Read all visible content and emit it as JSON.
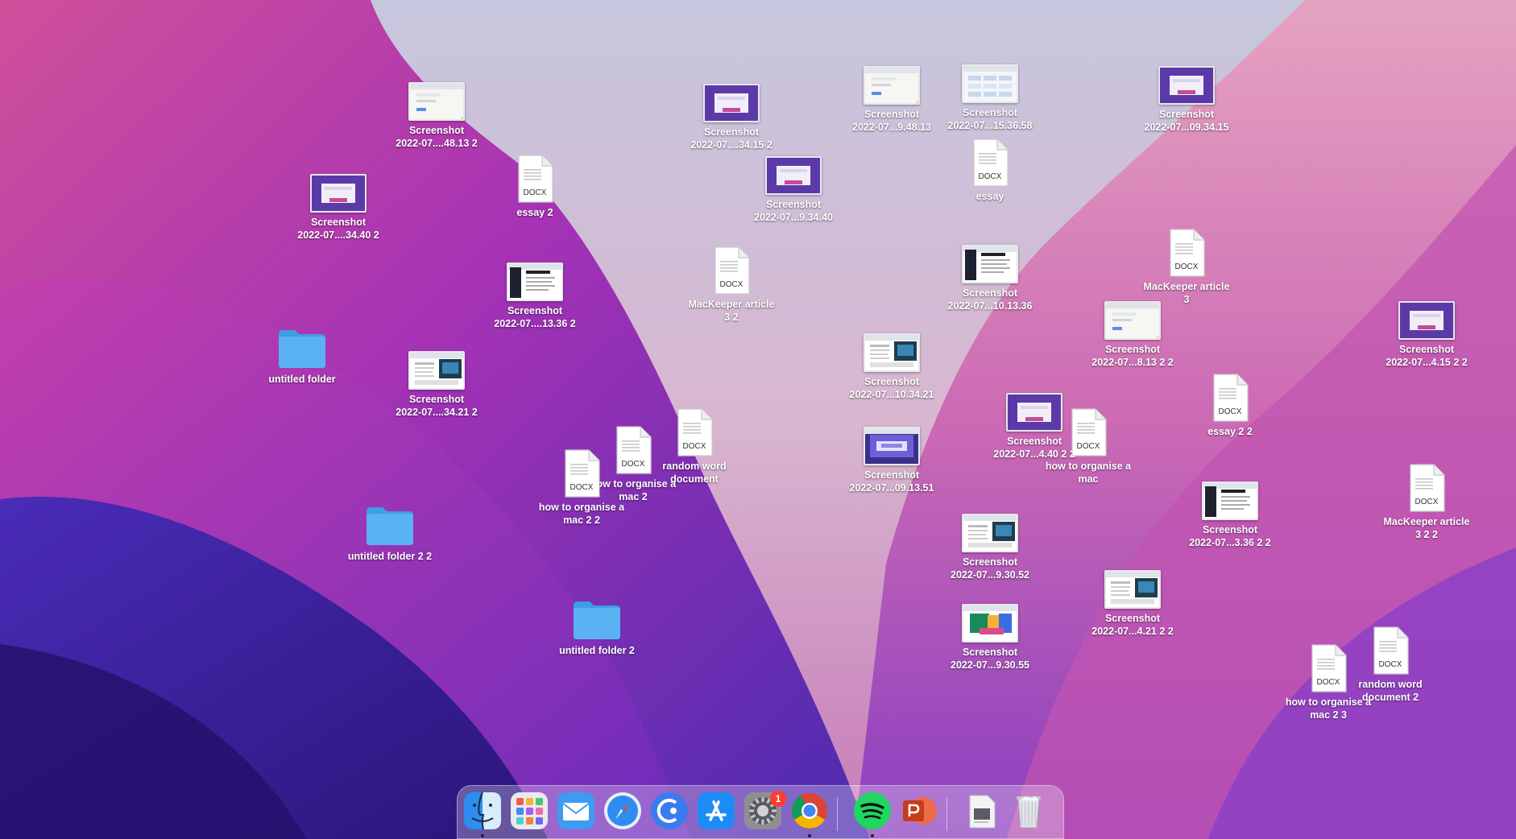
{
  "desktop_items": [
    {
      "label": "Screenshot\n2022-07....48.13 2",
      "kind": "screenshot",
      "theme": "light-yellow"
    },
    {
      "label": "Screenshot\n2022-07....34.15 2",
      "kind": "screenshot",
      "theme": "purple-form"
    },
    {
      "label": "Screenshot\n2022-07...9.48.13",
      "kind": "screenshot",
      "theme": "light-yellow"
    },
    {
      "label": "Screenshot\n2022-07...15.36.58",
      "kind": "screenshot",
      "theme": "table"
    },
    {
      "label": "Screenshot\n2022-07...09.34.15",
      "kind": "screenshot",
      "theme": "purple-form"
    },
    {
      "label": "Screenshot\n2022-07....34.40 2",
      "kind": "screenshot",
      "theme": "purple-form"
    },
    {
      "label": "essay 2",
      "kind": "docx"
    },
    {
      "label": "Screenshot\n2022-07...9.34.40",
      "kind": "screenshot",
      "theme": "purple-form"
    },
    {
      "label": "essay",
      "kind": "docx"
    },
    {
      "label": "Screenshot\n2022-07....13.36 2",
      "kind": "screenshot",
      "theme": "dark-article"
    },
    {
      "label": "MacKeeper article\n3 2",
      "kind": "docx"
    },
    {
      "label": "Screenshot\n2022-07...10.13.36",
      "kind": "screenshot",
      "theme": "dark-article"
    },
    {
      "label": "MacKeeper article\n3",
      "kind": "docx"
    },
    {
      "label": "Screenshot\n2022-07...8.13 2 2",
      "kind": "screenshot",
      "theme": "light-yellow"
    },
    {
      "label": "Screenshot\n2022-07...4.15 2 2",
      "kind": "screenshot",
      "theme": "purple-form"
    },
    {
      "label": "untitled folder",
      "kind": "folder"
    },
    {
      "label": "Screenshot\n2022-07....34.21 2",
      "kind": "screenshot",
      "theme": "web-page"
    },
    {
      "label": "Screenshot\n2022-07...10.34.21",
      "kind": "screenshot",
      "theme": "web-page"
    },
    {
      "label": "essay 2 2",
      "kind": "docx"
    },
    {
      "label": "Screenshot\n2022-07...4.40 2 2",
      "kind": "screenshot",
      "theme": "purple-form"
    },
    {
      "label": "how to organise a\nmac",
      "kind": "docx"
    },
    {
      "label": "random word\ndocument",
      "kind": "docx"
    },
    {
      "label": "how to organise a\nmac 2",
      "kind": "docx"
    },
    {
      "label": "how to organise a\nmac 2 2",
      "kind": "docx"
    },
    {
      "label": "Screenshot\n2022-07...09.13.51",
      "kind": "screenshot",
      "theme": "blue-dark"
    },
    {
      "label": "Screenshot\n2022-07...3.36 2 2",
      "kind": "screenshot",
      "theme": "dark-article"
    },
    {
      "label": "MacKeeper article\n3 2 2",
      "kind": "docx"
    },
    {
      "label": "untitled folder 2 2",
      "kind": "folder"
    },
    {
      "label": "Screenshot\n2022-07...9.30.52",
      "kind": "screenshot",
      "theme": "web-page"
    },
    {
      "label": "untitled folder 2",
      "kind": "folder"
    },
    {
      "label": "Screenshot\n2022-07...4.21 2 2",
      "kind": "screenshot",
      "theme": "web-page"
    },
    {
      "label": "Screenshot\n2022-07...9.30.55",
      "kind": "screenshot",
      "theme": "colorful"
    },
    {
      "label": "random word\ndocument 2",
      "kind": "docx"
    },
    {
      "label": "how to organise a\nmac 2 3",
      "kind": "docx"
    }
  ],
  "docx_tag": "DOCX",
  "dock": {
    "apps": [
      {
        "name": "Finder",
        "icon": "finder-icon",
        "running": true
      },
      {
        "name": "Launchpad",
        "icon": "launchpad-icon",
        "running": false
      },
      {
        "name": "Mail",
        "icon": "mail-icon",
        "running": false
      },
      {
        "name": "Safari",
        "icon": "safari-icon",
        "running": false
      },
      {
        "name": "Cleaner",
        "icon": "cleaner-icon",
        "running": false
      },
      {
        "name": "App Store",
        "icon": "app-store-icon",
        "running": false
      },
      {
        "name": "System Preferences",
        "icon": "system-preferences-icon",
        "running": false,
        "badge": "1"
      },
      {
        "name": "Google Chrome",
        "icon": "chrome-icon",
        "running": true
      },
      {
        "name": "Spotify",
        "icon": "spotify-icon",
        "running": true
      },
      {
        "name": "Microsoft PowerPoint",
        "icon": "powerpoint-icon",
        "running": false
      },
      {
        "name": "Documents",
        "icon": "documents-stack-icon",
        "running": false
      },
      {
        "name": "Trash",
        "icon": "trash-icon",
        "running": false
      }
    ]
  },
  "colors": {
    "wallpaper_top_left": "#c84b97",
    "wallpaper_sky": "#c9c8dd",
    "wallpaper_bottom": "#3a1f9e",
    "folder_blue": "#5ab2f2",
    "label_white": "#ffffff",
    "badge_red": "#ff3b30"
  }
}
